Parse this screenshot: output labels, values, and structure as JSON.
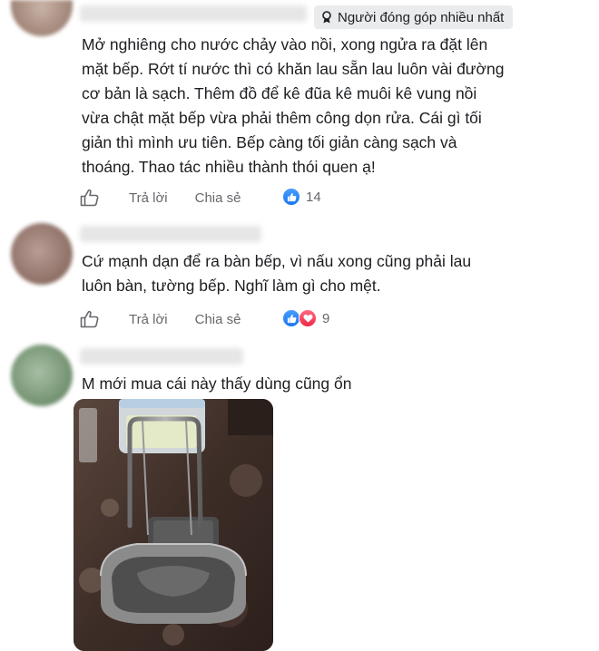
{
  "comments": [
    {
      "badge": "Người đóng góp nhiều nhất",
      "text_lines": [
        "Mở nghiêng cho nước chảy vào nồi, xong ngửa ra đặt lên",
        "mặt bếp. Rớt tí nước thì có khăn lau sẵn lau luôn vài đường",
        "cơ bản là sạch. Thêm đồ để kê đũa kê muôi kê vung nồi",
        "vừa chật mặt bếp vừa phải thêm công dọn rửa. Cái gì tối",
        "giản thì mình ưu tiên. Bếp càng tối giản càng sạch và",
        "thoáng. Thao tác nhiều thành thói quen ạ!"
      ],
      "reply_label": "Trả lời",
      "share_label": "Chia sẻ",
      "reaction_count": "14"
    },
    {
      "text_lines": [
        "Cứ mạnh dạn để ra bàn bếp, vì nấu xong cũng phải lau",
        "luôn bàn, tường bếp. Nghĩ làm gì cho mệt."
      ],
      "reply_label": "Trả lời",
      "share_label": "Chia sẻ",
      "reaction_count": "9"
    },
    {
      "text_lines": [
        "M mới mua cái này thấy dùng cũng ổn"
      ]
    }
  ],
  "icons": {
    "badge": "award-icon",
    "like_action": "thumbs-up-outline-icon",
    "reaction_like": "like-reaction-icon",
    "reaction_love": "love-reaction-icon"
  },
  "colors": {
    "like_blue": "#1877f2",
    "love_red": "#f0284a",
    "muted_text": "#65676b",
    "badge_bg": "#eaebed"
  }
}
